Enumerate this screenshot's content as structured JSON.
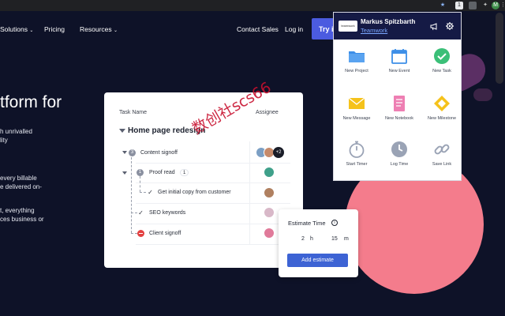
{
  "browser": {
    "icons": [
      "star-icon",
      "extension-badge-icon",
      "extension-badge-icon",
      "puzzle-icon",
      "profile-avatar-icon",
      "menu-icon"
    ],
    "ext_badge_text": "1",
    "profile_initial": "M"
  },
  "site_nav": {
    "items": [
      "Solutions",
      "Pricing",
      "Resources"
    ],
    "contact": "Contact Sales",
    "login": "Log in",
    "cta": "Try i"
  },
  "hero": {
    "title": "tform for",
    "lines": [
      "h unrivalled",
      "lity",
      "every billable",
      "e delivered on-",
      "",
      "t, everything",
      "ces business or"
    ]
  },
  "task_card": {
    "columns": {
      "task": "Task Name",
      "assignee": "Assignee"
    },
    "group": "Home page redesign",
    "tasks": [
      {
        "label": "Content signoff",
        "badge": "3"
      },
      {
        "label": "Proof read",
        "badge": "1",
        "subcount": "1"
      },
      {
        "label": "Get initial copy from customer"
      },
      {
        "label": "SEO keywords"
      },
      {
        "label": "Client signoff"
      }
    ],
    "more_assignees": "+2"
  },
  "estimate": {
    "title": "Estimate Time",
    "info": "i",
    "hours": "2",
    "hours_unit": "h",
    "minutes": "15",
    "minutes_unit": "m",
    "button": "Add estimate"
  },
  "popup": {
    "logo_text": "teamwork",
    "user": "Markus Spitzbarth",
    "org": "Teamwork",
    "tiles": [
      {
        "label": "New Project",
        "icon": "folder-icon",
        "color": "#3d8fe8"
      },
      {
        "label": "New Event",
        "icon": "calendar-icon",
        "color": "#3d8fe8"
      },
      {
        "label": "New Task",
        "icon": "check-circle-icon",
        "color": "#3bbf78"
      },
      {
        "label": "New Message",
        "icon": "envelope-icon",
        "color": "#f5c21b"
      },
      {
        "label": "New Notebook",
        "icon": "notebook-icon",
        "color": "#ee7fb3"
      },
      {
        "label": "New Milestone",
        "icon": "milestone-diamond-icon",
        "color": "#f5c21b"
      },
      {
        "label": "Start Timer",
        "icon": "stopwatch-icon",
        "color": "#9aa3b5"
      },
      {
        "label": "Log Time",
        "icon": "clock-icon",
        "color": "#9aa3b5"
      },
      {
        "label": "Save Link",
        "icon": "link-icon",
        "color": "#9aa3b5"
      }
    ]
  },
  "watermark": "数创社scs66",
  "colors": {
    "page_bg": "#0e1228",
    "popup_header": "#151a45",
    "cta": "#4b5be0",
    "accent_button": "#3d63d4",
    "pink_shape": "#f47c8c"
  }
}
